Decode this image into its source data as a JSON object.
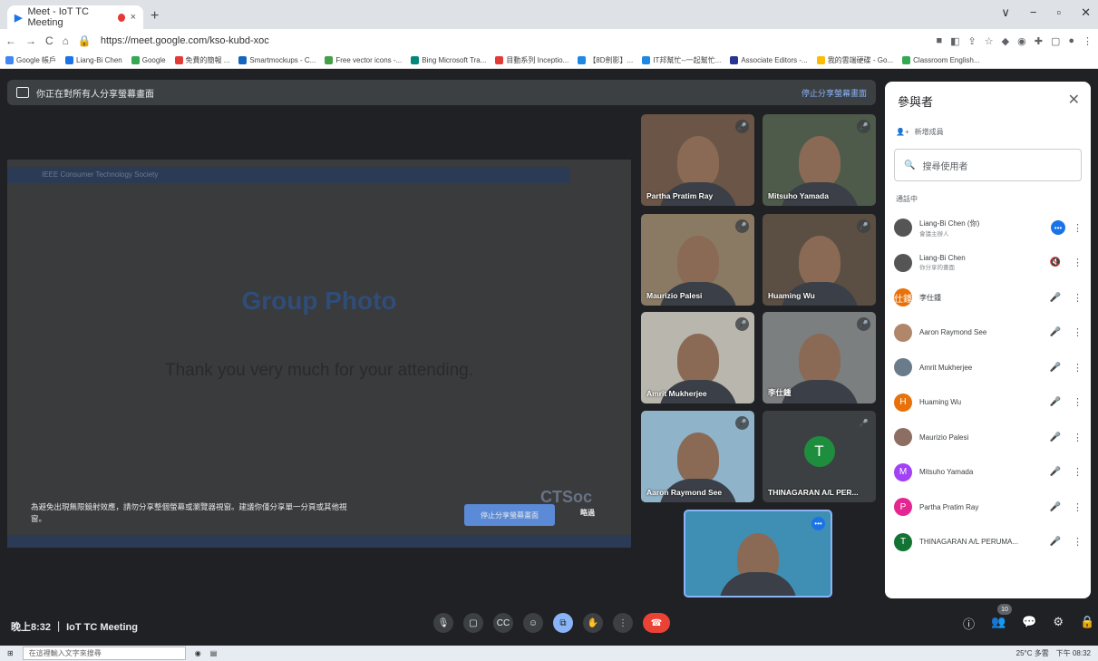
{
  "browser": {
    "tab_title": "Meet - IoT TC Meeting",
    "tab_close": "×",
    "new_tab": "+",
    "url": "https://meet.google.com/kso-kubd-xoc",
    "nav": [
      "←",
      "→",
      "C",
      "⌂"
    ],
    "window_controls": [
      "∨",
      "−",
      "▫",
      "✕"
    ],
    "bookmarks": [
      {
        "label": "Google 帳戶",
        "color": "#4285f4"
      },
      {
        "label": "Liang-Bi Chen",
        "color": "#1a73e8"
      },
      {
        "label": "Google",
        "color": "#34a853"
      },
      {
        "label": "免費的簡報 ...",
        "color": "#e53935"
      },
      {
        "label": "Smartmockups - C...",
        "color": "#1565c0"
      },
      {
        "label": "Free vector icons -...",
        "color": "#43a047"
      },
      {
        "label": "Bing Microsoft Tra...",
        "color": "#00897b"
      },
      {
        "label": "目動系列 Inceptio...",
        "color": "#e53935"
      },
      {
        "label": "【8D劍影】...",
        "color": "#1e88e5"
      },
      {
        "label": "IT邦幫忙--一起幫忙...",
        "color": "#1e88e5"
      },
      {
        "label": "Associate Editors -...",
        "color": "#283593"
      },
      {
        "label": "我的雲端硬碟 - Go...",
        "color": "#fbbc04"
      },
      {
        "label": "Classroom English...",
        "color": "#34a853"
      }
    ]
  },
  "presentation_bar": {
    "text": "你正在對所有人分享螢幕畫面",
    "stop": "停止分享螢幕畫面"
  },
  "slide": {
    "header": "IEEE Consumer Technology Society",
    "title": "Group Photo",
    "subtitle": "Thank you very much for your attending.",
    "notice": "為避免出現無限鏡射效應，請勿分享整個螢幕或瀏覽器視窗。建議你僅分享單一分頁或其他視窗。",
    "stop_button": "停止分享螢幕畫面",
    "dismiss": "略過",
    "logo": "CTSoc"
  },
  "tiles": [
    {
      "name": "Partha Pratim Ray",
      "bg": "#6b5546"
    },
    {
      "name": "Mitsuho Yamada",
      "bg": "#4e5a4a"
    },
    {
      "name": "Maurizio Palesi",
      "bg": "#8a7a64"
    },
    {
      "name": "Huaming Wu",
      "bg": "#5a4f42"
    },
    {
      "name": "Amrit Mukherjee",
      "bg": "#b9b6ad"
    },
    {
      "name": "李仕鍾",
      "bg": "#7c7f80"
    },
    {
      "name": "Aaron Raymond See",
      "bg": "#8fb3c9"
    },
    {
      "name": "THINAGARAN A/L PER...",
      "bg": "#3c4043",
      "avatar": "T"
    }
  ],
  "self_tile": {
    "bg": "#3f8fb5"
  },
  "panel": {
    "title": "參與者",
    "close": "✕",
    "add": "新增成員",
    "search_placeholder": "搜尋使用者",
    "in_call": "通話中",
    "participants": [
      {
        "name": "Liang-Bi Chen (你)",
        "sub": "會議主辦人",
        "color": "#555",
        "initial": "",
        "mic": "•••",
        "active": true
      },
      {
        "name": "Liang-Bi Chen",
        "sub": "你分享的畫面",
        "color": "#555",
        "initial": "",
        "mic": "🔇"
      },
      {
        "name": "李仕鍾",
        "sub": "",
        "color": "#e8710a",
        "initial": "仕鍾",
        "mic": "🎤"
      },
      {
        "name": "Aaron Raymond See",
        "sub": "",
        "color": "#b0876b",
        "initial": "",
        "mic": "🎤"
      },
      {
        "name": "Amrit Mukherjee",
        "sub": "",
        "color": "#6a7b8c",
        "initial": "",
        "mic": "🎤"
      },
      {
        "name": "Huaming Wu",
        "sub": "",
        "color": "#e8710a",
        "initial": "H",
        "mic": "🎤"
      },
      {
        "name": "Maurizio Palesi",
        "sub": "",
        "color": "#8d6e63",
        "initial": "",
        "mic": "🎤"
      },
      {
        "name": "Mitsuho Yamada",
        "sub": "",
        "color": "#a142f4",
        "initial": "M",
        "mic": "🎤"
      },
      {
        "name": "Partha Pratim Ray",
        "sub": "",
        "color": "#e52592",
        "initial": "P",
        "mic": "🎤"
      },
      {
        "name": "THINAGARAN A/L PERUMA...",
        "sub": "",
        "color": "#137333",
        "initial": "T",
        "mic": "🎤"
      }
    ]
  },
  "bottom": {
    "meeting_info": "晚上8:32 ｜ IoT TC Meeting",
    "controls": [
      "🎙",
      "▢",
      "CC",
      "☺",
      "⧉",
      "✋",
      "⋮",
      "☎"
    ],
    "right_controls": [
      "ⓘ",
      "👥",
      "💬",
      "⚙",
      "🔒"
    ],
    "participant_count": "10"
  },
  "taskbar": {
    "search": "在這裡輸入文字來搜尋",
    "tray": "25°C 多雲",
    "time": "下午 08:32"
  }
}
